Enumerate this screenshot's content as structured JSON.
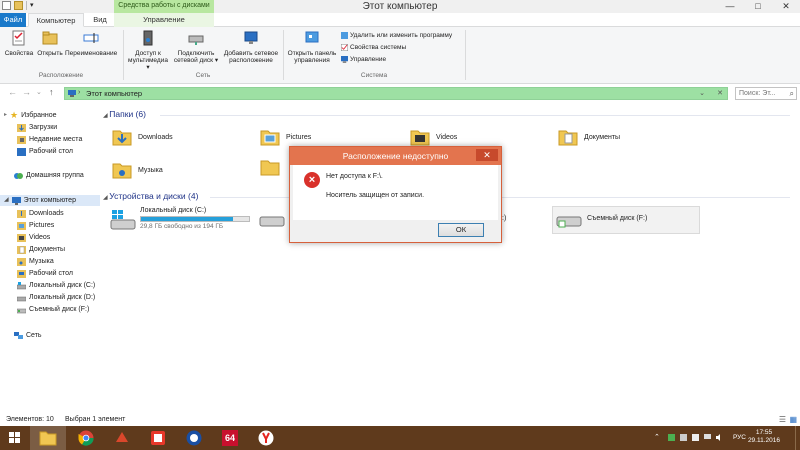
{
  "window": {
    "title": "Этот компьютер",
    "context_group": "Средства работы с дисками",
    "controls": {
      "minimize": "—",
      "maximize": "□",
      "close": "✕"
    }
  },
  "ribbon_tabs": {
    "file": "Файл",
    "computer": "Компьютер",
    "view": "Вид",
    "manage": "Управление"
  },
  "ribbon": {
    "location": {
      "label": "Расположение",
      "properties": "Свойства",
      "open": "Открыть",
      "rename": "Переименование"
    },
    "network": {
      "label": "Сеть",
      "media_access_1": "Доступ к",
      "media_access_2": "мультимедиа ▾",
      "map_drive_1": "Подключить",
      "map_drive_2": "сетевой диск ▾",
      "add_location_1": "Добавить сетевое",
      "add_location_2": "расположение"
    },
    "system": {
      "label": "Система",
      "control_panel_1": "Открыть панель",
      "control_panel_2": "управления",
      "uninstall": "Удалить или изменить программу",
      "sys_props": "Свойства системы",
      "manage": "Управление"
    }
  },
  "addressbar": {
    "path": "Этот компьютер",
    "search_placeholder": "Поиск: Эт..."
  },
  "navpane": {
    "favorites": "Избранное",
    "downloads": "Загрузки",
    "recent": "Недавние места",
    "desktop": "Рабочий стол",
    "homegroup": "Домашняя группа",
    "this_pc": "Этот компьютер",
    "pc_items": [
      "Downloads",
      "Pictures",
      "Videos",
      "Документы",
      "Музыка",
      "Рабочий стол",
      "Локальный диск (C:)",
      "Локальный диск (D:)",
      "Съемный диск (F:)"
    ],
    "network": "Сеть"
  },
  "content": {
    "folders_header": "Папки (6)",
    "folders": [
      "Downloads",
      "Pictures",
      "Videos",
      "Документы",
      "Музыка"
    ],
    "devices_header": "Устройства и диски (4)",
    "drive_c_name": "Локальный диск (C:)",
    "drive_c_free": "29,8 ГБ свободно из 194 ГБ",
    "drive_c_used_fraction": 0.85,
    "drive_f_name": "Съемный диск (F:)",
    "partial_text": ":)"
  },
  "status": {
    "items": "Элементов: 10",
    "selected": "Выбран 1 элемент"
  },
  "dialog": {
    "title": "Расположение недоступно",
    "close": "✕",
    "message1": "Нет доступа к F:\\.",
    "message2": "Носитель защищен от записи.",
    "ok": "ОК"
  },
  "taskbar": {
    "app_64": "64",
    "lang": "РУС",
    "time": "17:55",
    "date": "29.11.2016"
  },
  "colors": {
    "accent": "#1979ca",
    "address_bg": "#9de0a3",
    "dialog_title": "#e3744e",
    "taskbar": "#5f3a1c"
  }
}
